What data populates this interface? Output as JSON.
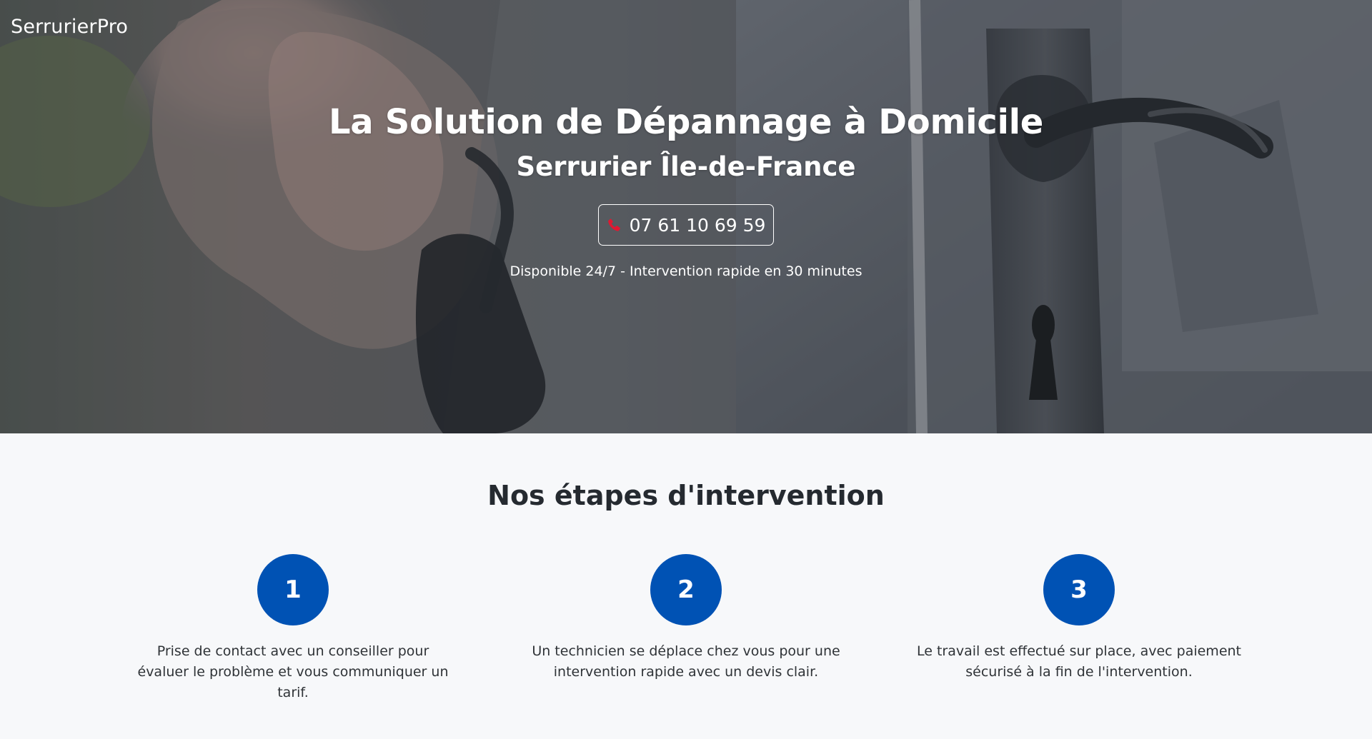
{
  "brand": {
    "name": "SerrurierPro"
  },
  "hero": {
    "title": "La Solution de Dépannage à Domicile",
    "subtitle": "Serrurier Île-de-France",
    "phone": "07 61 10 69 59",
    "phone_icon": "phone-icon",
    "phone_icon_color": "#e01831",
    "availability": "Disponible 24/7 - Intervention rapide en 30 minutes"
  },
  "steps": {
    "title": "Nos étapes d'intervention",
    "items": [
      {
        "number": "1",
        "text": "Prise de contact avec un conseiller pour évaluer le problème et vous communiquer un tarif."
      },
      {
        "number": "2",
        "text": "Un technicien se déplace chez vous pour une intervention rapide avec un devis clair."
      },
      {
        "number": "3",
        "text": "Le travail est effectué sur place, avec paiement sécurisé à la fin de l'intervention."
      }
    ]
  },
  "colors": {
    "primary_blue": "#0052b4",
    "page_background": "#f7f8fa",
    "hero_text": "#ffffff"
  }
}
